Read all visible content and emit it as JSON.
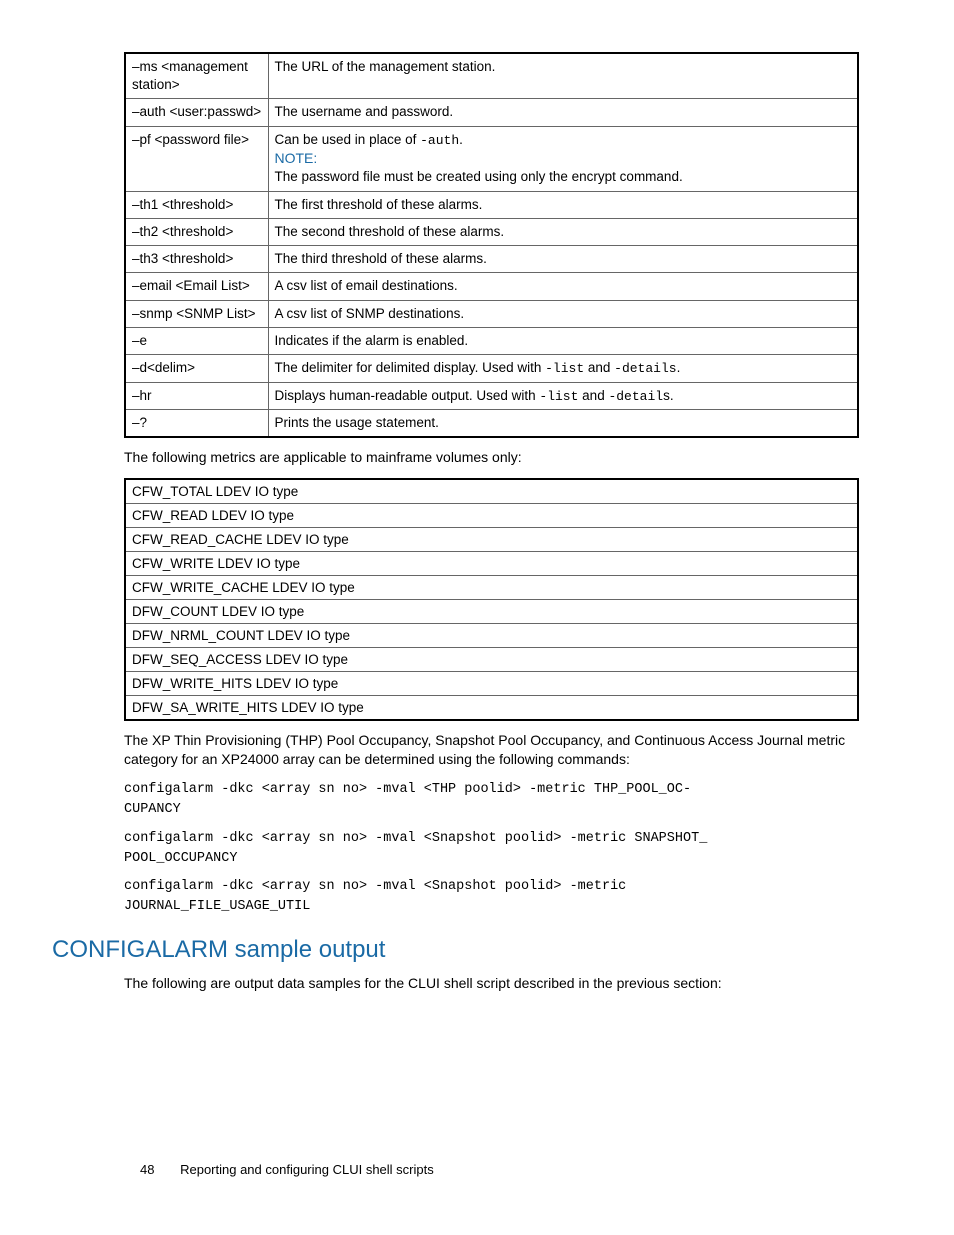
{
  "options_table": [
    {
      "opt": "–ms <management station>",
      "desc_text": "The URL of the management station."
    },
    {
      "opt": "–auth <user:passwd>",
      "desc_text": "The username and password."
    },
    {
      "opt": "–pf <password file>",
      "desc_parts": [
        {
          "t": "text",
          "v": "Can be used in place of "
        },
        {
          "t": "mono",
          "v": "-auth"
        },
        {
          "t": "text",
          "v": "."
        },
        {
          "t": "br"
        },
        {
          "t": "note",
          "v": "NOTE:"
        },
        {
          "t": "br"
        },
        {
          "t": "text",
          "v": "The password file must be created using only the encrypt command."
        }
      ]
    },
    {
      "opt": "–th1 <threshold>",
      "desc_text": "The first threshold of these alarms."
    },
    {
      "opt": "–th2 <threshold>",
      "desc_text": "The second threshold of these alarms."
    },
    {
      "opt": "–th3 <threshold>",
      "desc_text": "The third threshold of these alarms."
    },
    {
      "opt": "–email <Email List>",
      "desc_text": "A csv list of email destinations."
    },
    {
      "opt": "–snmp <SNMP List>",
      "desc_text": "A csv list of SNMP destinations."
    },
    {
      "opt": "–e",
      "desc_text": "Indicates if the alarm is enabled."
    },
    {
      "opt": "–d<delim>",
      "desc_parts": [
        {
          "t": "text",
          "v": "The delimiter for delimited display. Used with "
        },
        {
          "t": "mono",
          "v": "-list"
        },
        {
          "t": "text",
          "v": " and "
        },
        {
          "t": "mono",
          "v": "-details"
        },
        {
          "t": "text",
          "v": "."
        }
      ]
    },
    {
      "opt": "–hr",
      "desc_parts": [
        {
          "t": "text",
          "v": "Displays human-readable output. Used with "
        },
        {
          "t": "mono",
          "v": "-list"
        },
        {
          "t": "text",
          "v": " and "
        },
        {
          "t": "mono",
          "v": "-detail"
        },
        {
          "t": "text",
          "v": "s."
        }
      ]
    },
    {
      "opt": "–?",
      "desc_text": "Prints the usage statement."
    }
  ],
  "para_metrics_intro": "The following metrics are applicable to mainframe volumes only:",
  "metrics_table": [
    "CFW_TOTAL LDEV IO type",
    "CFW_READ LDEV IO type",
    "CFW_READ_CACHE LDEV IO type",
    "CFW_WRITE LDEV IO type",
    "CFW_WRITE_CACHE LDEV IO type",
    "DFW_COUNT LDEV IO type",
    "DFW_NRML_COUNT LDEV IO type",
    "DFW_SEQ_ACCESS LDEV IO type",
    "DFW_WRITE_HITS LDEV IO type",
    "DFW_SA_WRITE_HITS LDEV IO type"
  ],
  "para_thp": "The XP Thin Provisioning (THP) Pool Occupancy, Snapshot Pool Occupancy, and Continuous Access Journal metric category for an XP24000 array can be determined using the following commands:",
  "code1": "configalarm -dkc <array sn no> -mval <THP poolid> -metric THP_POOL_OC-\nCUPANCY",
  "code2": "configalarm -dkc <array sn no> -mval <Snapshot poolid> -metric SNAPSHOT_\nPOOL_OCCUPANCY",
  "code3": "configalarm -dkc <array sn no> -mval <Snapshot poolid> -metric\nJOURNAL_FILE_USAGE_UTIL",
  "section_heading": "CONFIGALARM sample output",
  "para_sample": "The following are output data samples for the CLUI shell script described in the previous section:",
  "footer": {
    "page": "48",
    "title": "Reporting and configuring CLUI shell scripts"
  }
}
